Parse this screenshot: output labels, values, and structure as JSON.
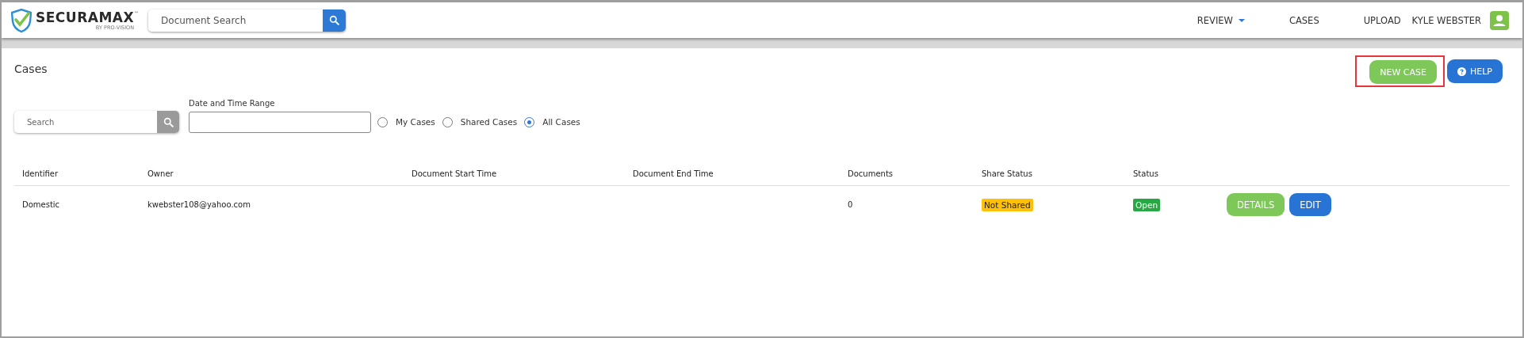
{
  "header": {
    "logo": {
      "name": "SECURAMAX",
      "tm": "™",
      "tagline": "BY PRO-VISION"
    },
    "search": {
      "placeholder": "Document Search"
    },
    "nav": [
      {
        "label": "REVIEW",
        "dropdown": true
      },
      {
        "label": "CASES",
        "dropdown": false
      },
      {
        "label": "UPLOAD",
        "dropdown": false
      }
    ],
    "user": {
      "name": "KYLE WEBSTER"
    }
  },
  "page": {
    "title": "Cases",
    "actions": [
      {
        "label": "NEW CASE",
        "kind": "primary",
        "highlighted": true
      },
      {
        "label": "HELP",
        "kind": "help",
        "highlighted": false
      }
    ]
  },
  "filters": {
    "search": {
      "placeholder": "Search"
    },
    "date_range": {
      "label": "Date and Time Range"
    },
    "scope": [
      {
        "label": "My Cases",
        "selected": false
      },
      {
        "label": "Shared Cases",
        "selected": false
      },
      {
        "label": "All Cases",
        "selected": true
      }
    ]
  },
  "table": {
    "columns": [
      "Identifier",
      "Owner",
      "Document Start Time",
      "Document End Time",
      "Documents",
      "Share Status",
      "Status"
    ],
    "rows": [
      {
        "identifier": "Domestic",
        "owner": "kwebster108@yahoo.com",
        "documents": "0",
        "share_status": {
          "label": "Not Shared",
          "color": "#ffc107"
        },
        "status": {
          "label": "Open",
          "color": "#28a745"
        },
        "actions": [
          {
            "label": "DETAILS",
            "kind": "details"
          },
          {
            "label": "EDIT",
            "kind": "edit"
          }
        ]
      }
    ]
  }
}
